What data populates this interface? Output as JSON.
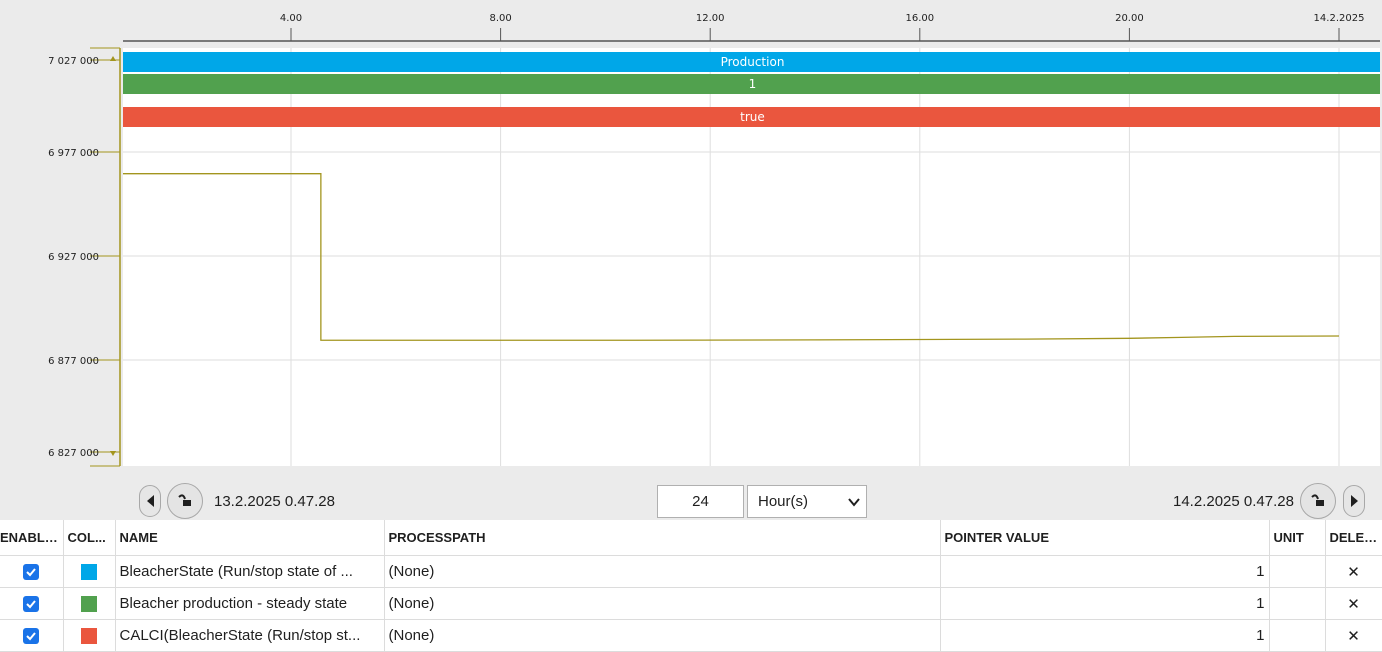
{
  "chart": {
    "x_ticks": [
      "4.00",
      "8.00",
      "12.00",
      "16.00",
      "20.00",
      "14.2.2025"
    ],
    "y_ticks": [
      "7 027 000",
      "6 977 000",
      "6 927 000",
      "6 877 000",
      "6 827 000"
    ],
    "band_labels": [
      "Production",
      "1",
      "true"
    ],
    "colors": {
      "band1": "#00a7e8",
      "band2": "#51a14e",
      "band3": "#ea563e",
      "trend_line": "#a3951e",
      "y_axis": "#a3951e",
      "grid": "#dedede"
    }
  },
  "chart_data": {
    "type": "line",
    "title": "",
    "xlabel": "",
    "ylabel": "",
    "x_unit": "hours since 13.2.2025 0.47.28",
    "xlim": [
      0,
      24
    ],
    "ylim": [
      6827000,
      7027000
    ],
    "series": [
      {
        "points": [
          [
            0,
            6969000
          ],
          [
            4.57,
            6969000
          ],
          [
            4.57,
            6884000
          ],
          [
            10,
            6884000
          ],
          [
            14,
            6884200
          ],
          [
            18,
            6884600
          ],
          [
            20,
            6885000
          ],
          [
            21,
            6885500
          ],
          [
            22,
            6886000
          ],
          [
            24,
            6886200
          ]
        ]
      }
    ],
    "bands": [
      {
        "label": "Production",
        "value": 1
      },
      {
        "label": "1",
        "value": 1
      },
      {
        "label": "true",
        "value": 1
      }
    ]
  },
  "navigation": {
    "start_time": "13.2.2025 0.47.28",
    "end_time": "14.2.2025 0.47.28",
    "span_value": "24",
    "span_unit": "Hour(s)"
  },
  "table": {
    "headers": [
      "ENABLED",
      "COL...",
      "NAME",
      "PROCESSPATH",
      "POINTER VALUE",
      "UNIT",
      "DELETE"
    ],
    "rows": [
      {
        "name": "BleacherState (Run/stop state of ...",
        "processpath": "(None)",
        "pointer_value": "1",
        "unit": "",
        "color": "#00a7e8"
      },
      {
        "name": "Bleacher production - steady state",
        "processpath": "(None)",
        "pointer_value": "1",
        "unit": "",
        "color": "#51a14e"
      },
      {
        "name": "CALCI(BleacherState (Run/stop st...",
        "processpath": "(None)",
        "pointer_value": "1",
        "unit": "",
        "color": "#ea563e"
      }
    ],
    "delete_glyph": "✕"
  }
}
